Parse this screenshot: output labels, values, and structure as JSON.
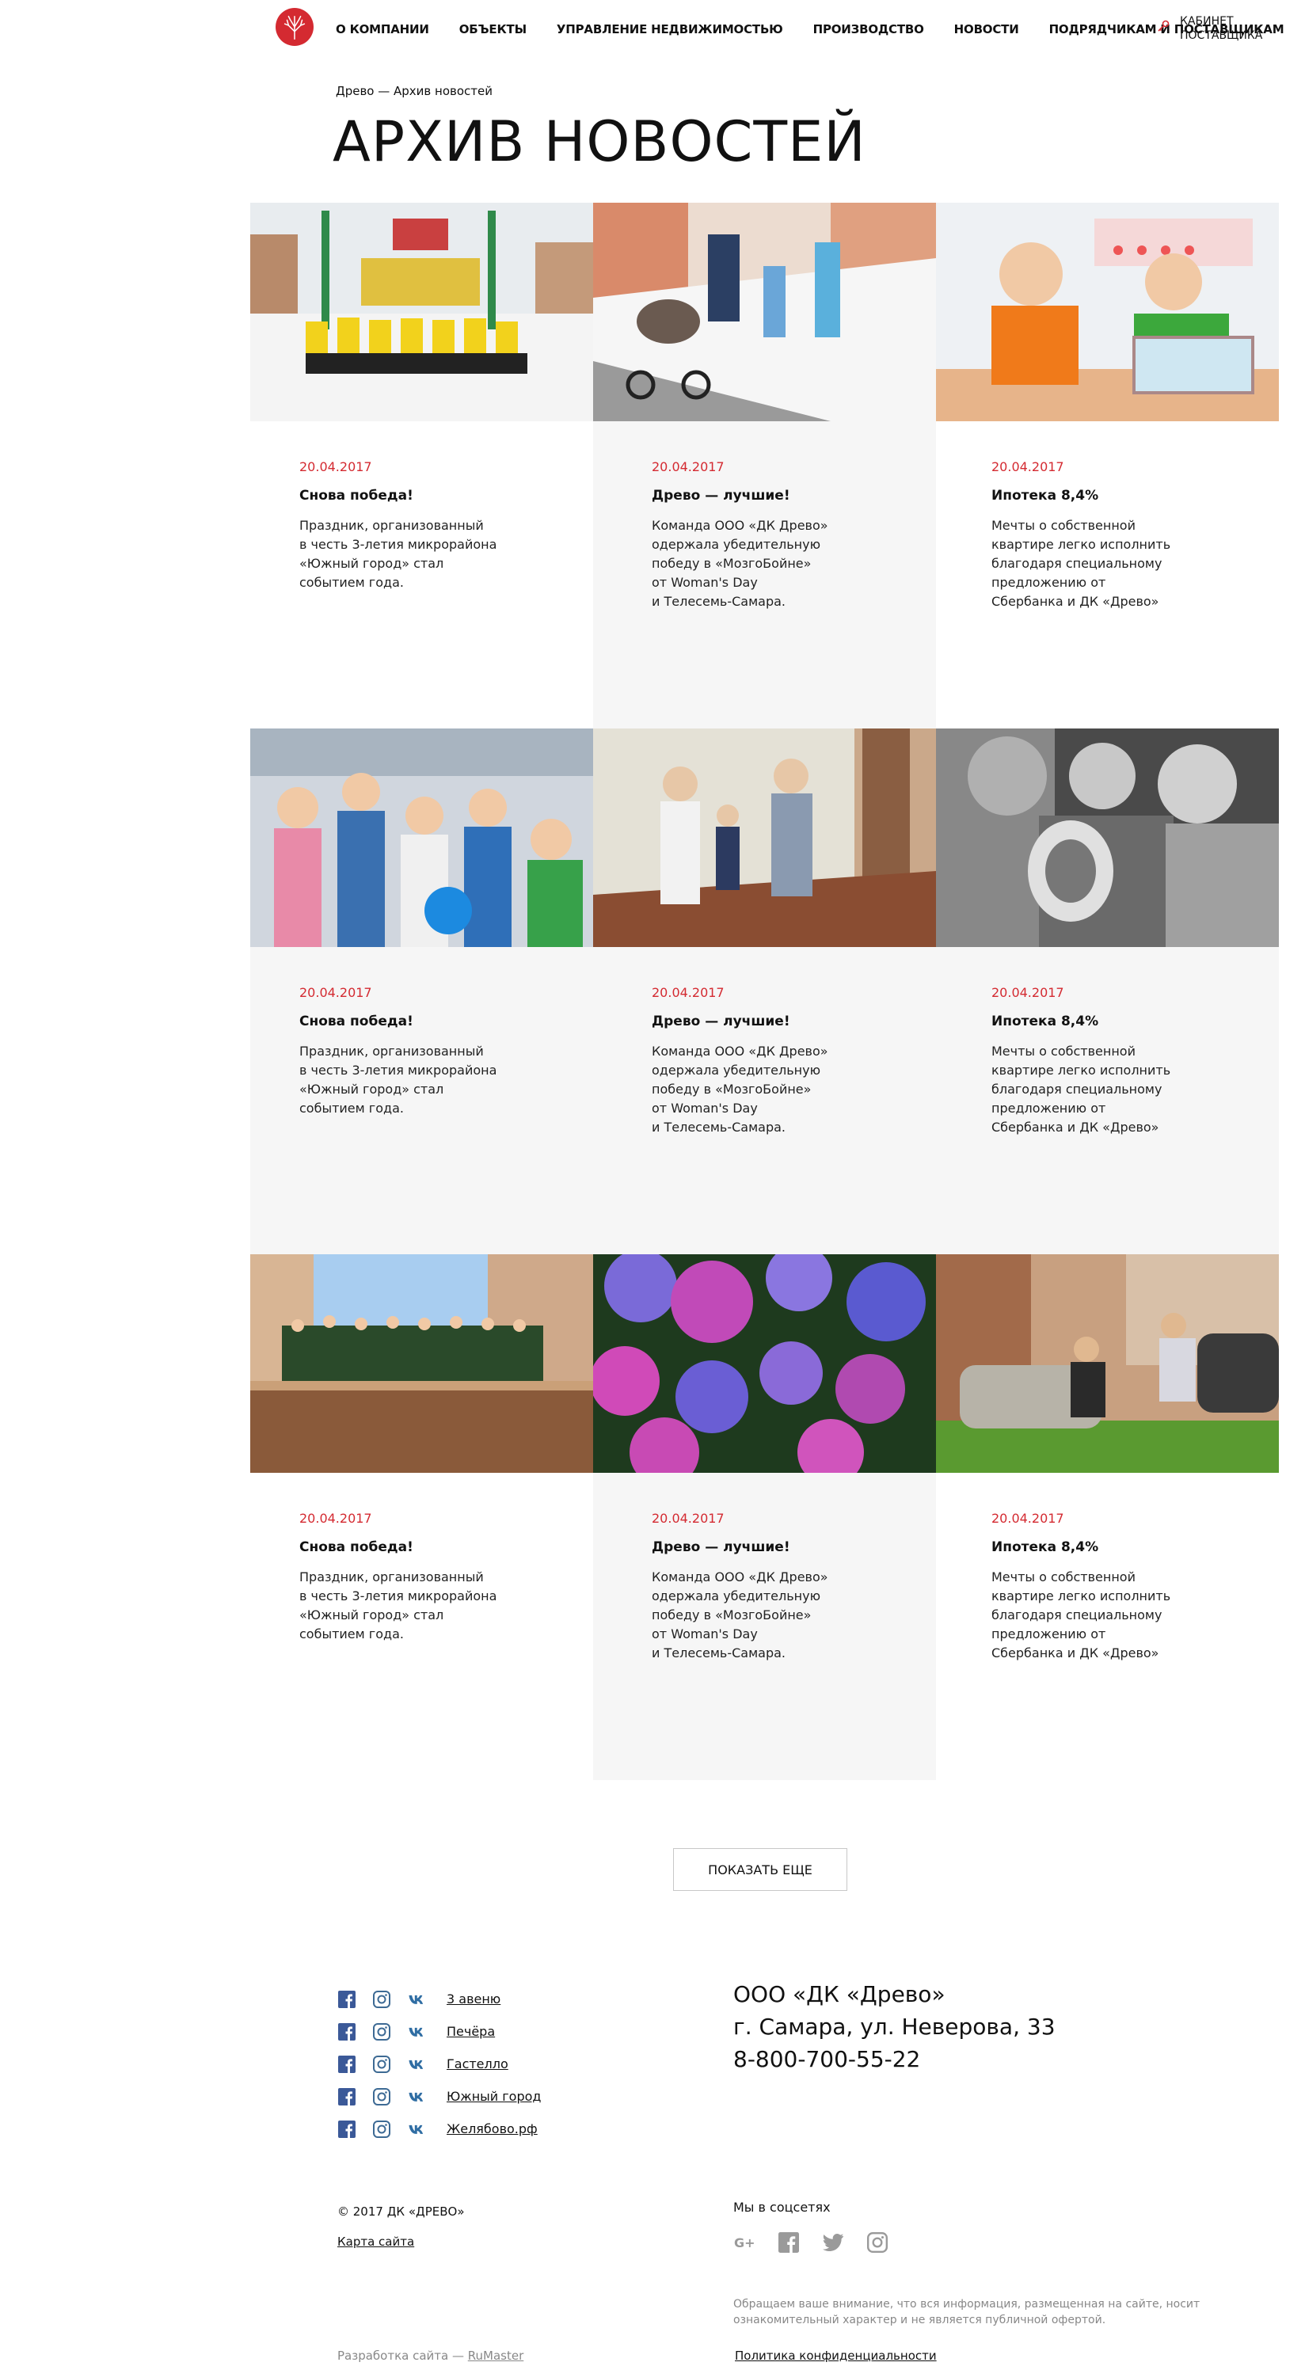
{
  "header": {
    "nav": [
      "О компании",
      "Объекты",
      "Управление недвижимостью",
      "Производство",
      "Новости",
      "Подрядчикам и поставщикам"
    ],
    "cabinet_label": "Кабинет поставщика"
  },
  "breadcrumb": "Древо — Архив новостей",
  "page_title": "Архив новостей",
  "colors": {
    "accent": "#d42a31",
    "card_grey": "#f6f6f6",
    "vk_blue": "#2f6da3"
  },
  "news": [
    {
      "date": "20.04.2017",
      "title": "Снова победа!",
      "text": "Праздник, организованный\nв честь 3-летия микрорайона\n«Южный город» стал\nсобытием года."
    },
    {
      "date": "20.04.2017",
      "title": "Древо — лучшие!",
      "text": "Команда ООО «ДК Древо»\nодержала убедительную\nпобеду в «МозгоБойне»\nот Woman's Day\nи Телесемь-Самара."
    },
    {
      "date": "20.04.2017",
      "title": "Ипотека 8,4%",
      "text": "Мечты о собственной\nквартире легко исполнить\nблагодаря специальному\nпредложению от\nСбербанка и ДК «Древо»"
    },
    {
      "date": "20.04.2017",
      "title": "Снова победа!",
      "text": "Праздник, организованный\nв честь 3-летия микрорайона\n«Южный город» стал\nсобытием года."
    },
    {
      "date": "20.04.2017",
      "title": "Древо — лучшие!",
      "text": "Команда ООО «ДК Древо»\nодержала убедительную\nпобеду в «МозгоБойне»\nот Woman's Day\nи Телесемь-Самара."
    },
    {
      "date": "20.04.2017",
      "title": "Ипотека 8,4%",
      "text": "Мечты о собственной\nквартире легко исполнить\nблагодаря специальному\nпредложению от\nСбербанка и ДК «Древо»"
    },
    {
      "date": "20.04.2017",
      "title": "Снова победа!",
      "text": "Праздник, организованный\nв честь 3-летия микрорайона\n«Южный город» стал\nсобытием года."
    },
    {
      "date": "20.04.2017",
      "title": "Древо — лучшие!",
      "text": "Команда ООО «ДК Древо»\nодержала убедительную\nпобеду в «МозгоБойне»\nот Woman's Day\nи Телесемь-Самара."
    },
    {
      "date": "20.04.2017",
      "title": "Ипотека 8,4%",
      "text": "Мечты о собственной\nквартире легко исполнить\nблагодаря специальному\nпредложению от\nСбербанка и ДК «Древо»"
    }
  ],
  "show_more": "Показать еще",
  "footer": {
    "projects": [
      "3 авеню",
      "Печёра",
      "Гастелло",
      "Южный город",
      "Желябово.рф"
    ],
    "company_name": "ООО «ДК «Древо»",
    "company_address": "г. Самара, ул. Неверова, 33",
    "company_phone": "8-800-700-55-22",
    "copyright": "© 2017 ДК «ДРЕВО»",
    "sitemap": "Карта сайта",
    "dev_prefix": "Разработка сайта — ",
    "dev_link": "RuMaster",
    "social_title": "Мы в соцсетях",
    "social_icons": [
      "google-plus-icon",
      "facebook-icon",
      "twitter-icon",
      "instagram-icon"
    ],
    "notice": "Обращаем ваше внимание, что вся информация, размещенная на сайте, носит ознакомительный характер и не является публичной офертой.",
    "privacy": "Политика конфиденциальности"
  }
}
